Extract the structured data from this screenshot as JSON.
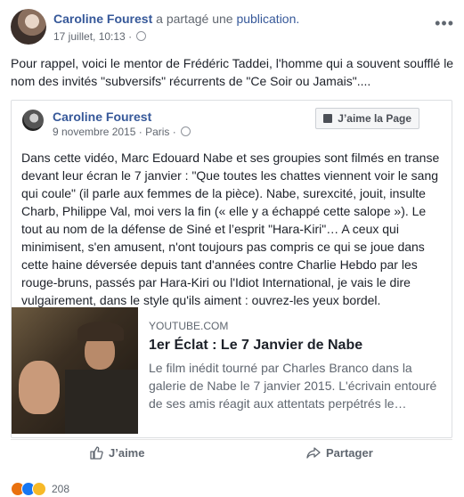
{
  "header": {
    "author": "Caroline Fourest",
    "shared_text": " a partagé une ",
    "publication": "publication.",
    "timestamp": "17 juillet, 10:13",
    "sep": " · ",
    "more_icon": "more-icon"
  },
  "post_text": "Pour rappel, voici le mentor de Frédéric Taddei, l'homme qui a souvent soufflé le nom des invités \"subversifs\" récurrents de \"Ce Soir ou Jamais\"....",
  "shared_post": {
    "author": "Caroline Fourest",
    "date": "9 novembre 2015",
    "location": "Paris",
    "sep": " · ",
    "like_page_label": "J’aime la Page",
    "text": "Dans cette vidéo, Marc Edouard Nabe et ses groupies sont filmés en transe devant leur écran le 7 janvier : \"Que toutes les chattes viennent voir le sang qui coule\" (il parle aux femmes de la pièce). Nabe, surexcité, jouit, insulte Charb, Philippe Val, moi vers la fin (« elle y a échappé cette salope »). Le tout au nom de la défense de Siné et l’esprit \"Hara-Kiri\"… A ceux qui minimisent, s'en amusent, n'ont toujours pas compris ce qui se joue dans cette haine déversée depuis tant d'années contre Charlie Hebdo par les rouge-bruns, passés par Hara-Kiri ou l'Idiot International, je vais le dire vulgairement, dans le style qu'ils aiment : ouvrez-les yeux bordel."
  },
  "link": {
    "domain": "YOUTUBE.COM",
    "title": "1er Éclat : Le 7 Janvier de Nabe",
    "description": "Le film inédit tourné par Charles Branco dans la galerie de Nabe le 7 janvier 2015. L'écrivain entouré de ses amis réagit aux attentats perpétrés le…"
  },
  "actions": {
    "like": "J’aime",
    "share": "Partager"
  },
  "reactions": {
    "count": "208",
    "types": [
      "angry",
      "like",
      "wow"
    ],
    "colors": {
      "angry": "#e9710f",
      "like": "#1877f2",
      "wow": "#f7b928"
    }
  }
}
